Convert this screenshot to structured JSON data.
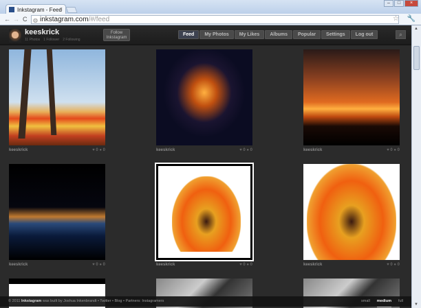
{
  "browser": {
    "tab_title": "Inkstagram - Feed",
    "url_host": "inkstagram.com",
    "url_path": "/#/feed"
  },
  "user": {
    "name": "keeskrick",
    "stats": [
      "11 Photos",
      "1 Follower",
      "2 Following"
    ]
  },
  "follow_label": "Follow Inkstagram",
  "menu": [
    "Feed",
    "My Photos",
    "My Likes",
    "Albums",
    "Popular",
    "Settings",
    "Log out"
  ],
  "photos": [
    {
      "user": "keeskrick",
      "likes": "0",
      "comments": "0"
    },
    {
      "user": "keeskrick",
      "likes": "0",
      "comments": "0"
    },
    {
      "user": "keeskrick",
      "likes": "0",
      "comments": "0"
    },
    {
      "user": "keeskrick",
      "likes": "0",
      "comments": "0"
    },
    {
      "user": "keeskrick",
      "likes": "0",
      "comments": "0"
    },
    {
      "user": "keeskrick",
      "likes": "0",
      "comments": "0"
    }
  ],
  "footer": {
    "prefix": "© 2011",
    "brand": "Inkstagram",
    "text": "was built by Joshua Inkenbrandt • Twitter • Blog • Partners: Instagramers",
    "sizes": [
      "small",
      "medium",
      "full"
    ]
  }
}
